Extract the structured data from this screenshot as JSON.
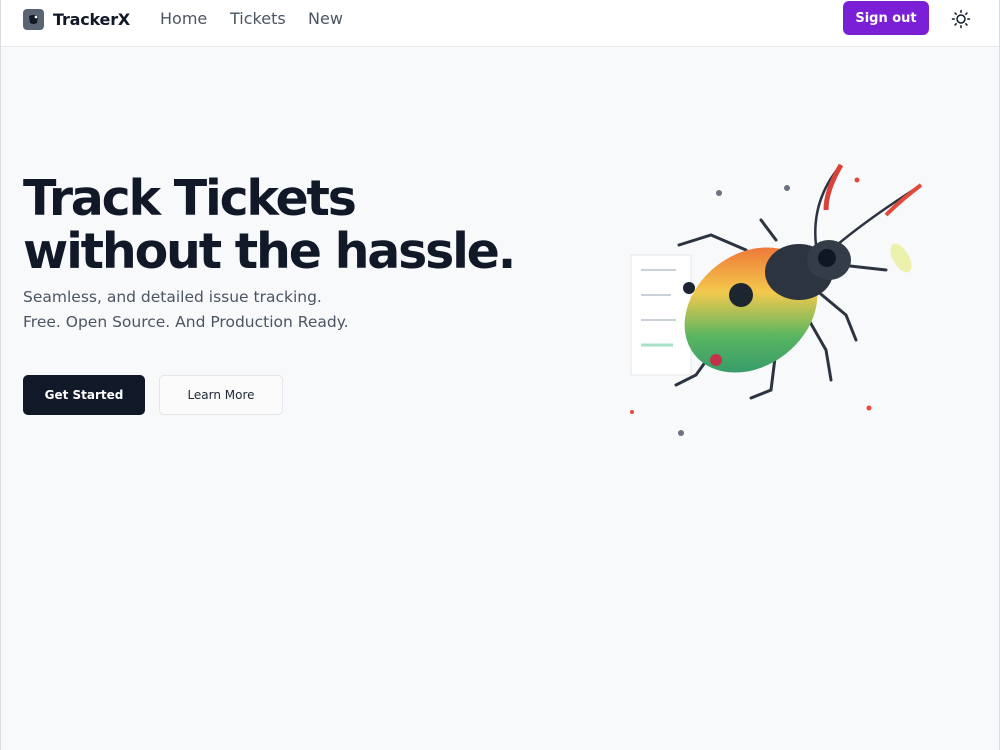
{
  "nav": {
    "brand": "TrackerX",
    "links": [
      "Home",
      "Tickets",
      "New"
    ],
    "sign_out_label": "Sign out",
    "theme_icon": "sun-icon",
    "logo_icon": "bug-icon",
    "accent": "#7b1fd6"
  },
  "hero": {
    "title_line1": "Track Tickets",
    "title_line2": "without the hassle.",
    "subtitle_line1": "Seamless, and detailed issue tracking.",
    "subtitle_line2": "Free. Open Source. And Production Ready.",
    "primary_button": "Get Started",
    "secondary_button": "Learn More",
    "illustration": "beetle-illustration"
  }
}
